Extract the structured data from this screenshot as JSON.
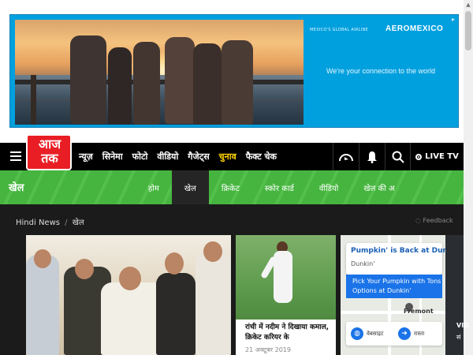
{
  "ad_banner": {
    "tagline": "MEXICO'S GLOBAL AIRLINE",
    "brand": "AEROMEXICO",
    "slogan": "We're your connection to the world"
  },
  "header": {
    "logo_text": "आज तक",
    "nav": [
      "न्यूज़",
      "सिनेमा",
      "फोटो",
      "वीडियो",
      "गैजेट्स",
      "चुनाव",
      "फैक्ट चेक"
    ],
    "highlight_item": "चुनाव",
    "live_tv_label": "LIVE TV"
  },
  "sports_bar": {
    "title": "खेल",
    "tabs": [
      "होम",
      "खेल",
      "क्रिकेट",
      "स्कोर कार्ड",
      "वीडियो",
      "खेल की अ"
    ],
    "active_tab": "खेल"
  },
  "breadcrumb": {
    "home": "Hindi News",
    "separator": "/",
    "current": "खेल",
    "feedback": "Feedback"
  },
  "mid_story": {
    "title": "रांची में नदीम ने दिखाया कमाल, क्रिकेट करियर के",
    "date": "21 अक्टूबर 2019"
  },
  "right_ad": {
    "title": "Pumpkin' is Back at Dunkin",
    "brand": "Dunkin'",
    "offer": "Pick Your Pumpkin with Tons Options at Dunkin'",
    "map_label": "Fremont",
    "action_1": "वेबसाइट",
    "action_2": "रास्ता"
  },
  "peek": {
    "line1": "VID",
    "line2": "सं"
  },
  "colors": {
    "brand_red": "#e91e25",
    "sports_green": "#46b53f",
    "header_black": "#000000",
    "highlight_yellow": "#ffd400",
    "ad_blue": "#00a0de"
  }
}
